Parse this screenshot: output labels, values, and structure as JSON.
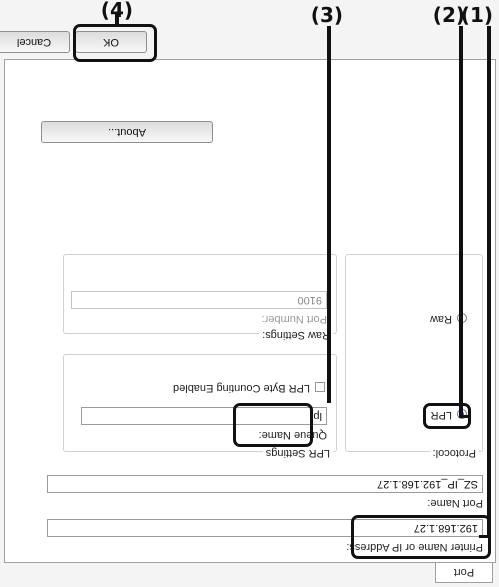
{
  "dialog": {
    "tab_label": "Port Settings",
    "printer_name_label": "Printer Name or IP Address:",
    "printer_name_value": "192.168.1.27",
    "port_name_label": "Port Name:",
    "port_name_value": "SZ_IP_192.168.1.27",
    "protocol_label": "Protocol:",
    "lpr_label": "LPR",
    "raw_label": "Raw",
    "lpr_settings_label": "LPR Settings",
    "queue_name_label": "Queue Name:",
    "queue_name_value": "lp",
    "lpr_byte_counting_label": "LPR Byte Counting Enabled",
    "raw_settings_label": "Raw Settings:",
    "port_number_label": "Port Number:",
    "port_number_value": "9100",
    "about_button": "About...",
    "ok_button": "OK",
    "cancel_button": "Cancel"
  },
  "callouts": {
    "c1": "(1)",
    "c2": "(2)",
    "c3": "(3)",
    "c4": "(4)"
  }
}
